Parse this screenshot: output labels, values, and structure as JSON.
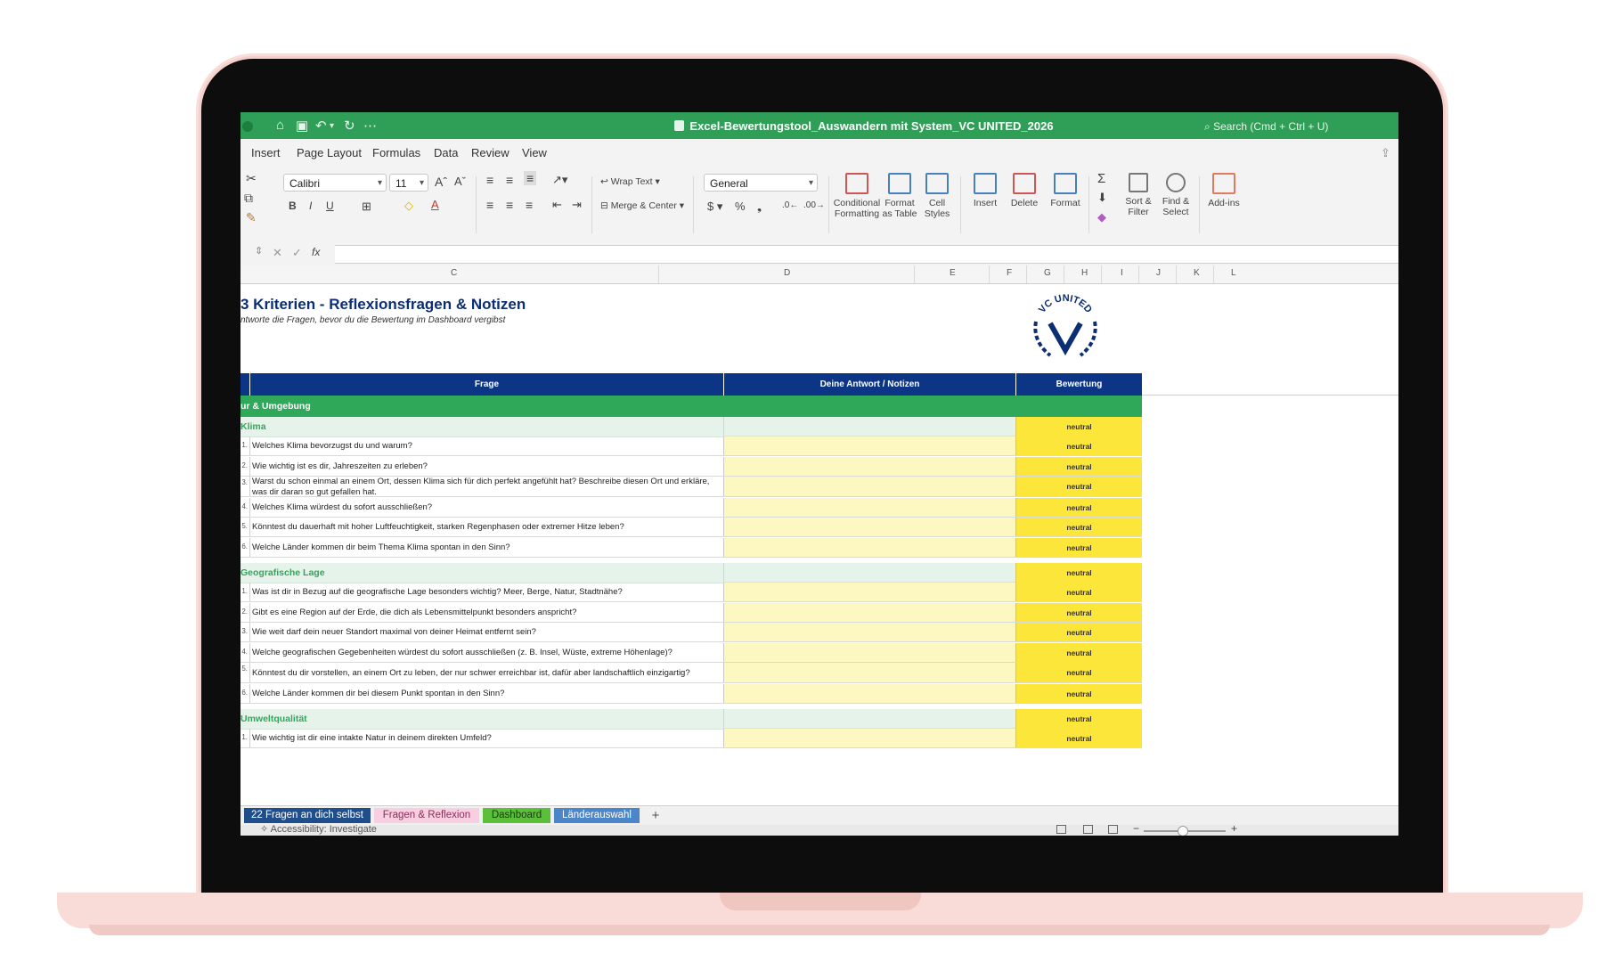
{
  "window": {
    "title": "Excel-Bewertungstool_Auswandern mit System_VC UNITED_2026",
    "search": "Search (Cmd + Ctrl + U)"
  },
  "menu": [
    "Insert",
    "Page Layout",
    "Formulas",
    "Data",
    "Review",
    "View"
  ],
  "ribbon": {
    "font_name": "Calibri",
    "font_size": "11",
    "wrap_text": "Wrap Text",
    "merge_center": "Merge & Center",
    "number_format": "General",
    "conditional_formatting": [
      "Conditional",
      "Formatting"
    ],
    "format_as_table": [
      "Format",
      "as Table"
    ],
    "cell_styles": [
      "Cell",
      "Styles"
    ],
    "insert": "Insert",
    "delete": "Delete",
    "format": "Format",
    "sort_filter": [
      "Sort &",
      "Filter"
    ],
    "find_select": [
      "Find &",
      "Select"
    ],
    "addins": "Add-ins",
    "fx": "fx"
  },
  "columns": [
    "C",
    "D",
    "E",
    "F",
    "G",
    "H",
    "I",
    "J",
    "K",
    "L"
  ],
  "sheet": {
    "title": "3 Kriterien - Reflexionsfragen & Notizen",
    "subtitle": "ntworte die Fragen, bevor du die Bewertung im Dashboard vergibst",
    "header": {
      "question": "Frage",
      "answer": "Deine Antwort / Notizen",
      "rating": "Bewertung"
    },
    "logo_text": "VC UNITED",
    "section": "ur & Umgebung",
    "categories": [
      {
        "label": "Klima",
        "rating": "neutral",
        "questions": [
          {
            "num": "1.",
            "text": "Welches Klima bevorzugst du und warum?",
            "rating": "neutral"
          },
          {
            "num": "2.",
            "text": "Wie wichtig ist es dir, Jahreszeiten zu erleben?",
            "rating": "neutral"
          },
          {
            "num": "3.",
            "text": "Warst du schon einmal an einem Ort, dessen Klima sich für dich perfekt angefühlt hat? Beschreibe diesen Ort und erkläre, was dir daran so gut gefallen hat.",
            "rating": "neutral"
          },
          {
            "num": "4.",
            "text": "Welches Klima würdest du sofort ausschließen?",
            "rating": "neutral"
          },
          {
            "num": "5.",
            "text": "Könntest du dauerhaft mit hoher Luftfeuchtigkeit, starken Regenphasen oder extremer Hitze leben?",
            "rating": "neutral"
          },
          {
            "num": "6.",
            "text": "Welche Länder kommen dir beim Thema Klima spontan in den Sinn?",
            "rating": "neutral"
          }
        ]
      },
      {
        "label": "Geografische Lage",
        "rating": "neutral",
        "questions": [
          {
            "num": "1.",
            "text": "Was ist dir in Bezug auf die geografische Lage besonders wichtig? Meer, Berge, Natur, Stadtnähe?",
            "rating": "neutral"
          },
          {
            "num": "2.",
            "text": "Gibt es eine Region auf der Erde, die dich als Lebensmittelpunkt besonders anspricht?",
            "rating": "neutral"
          },
          {
            "num": "3.",
            "text": "Wie weit darf dein neuer Standort maximal von deiner Heimat entfernt sein?",
            "rating": "neutral"
          },
          {
            "num": "4.",
            "text": "Welche geografischen Gegebenheiten würdest du sofort ausschließen (z. B. Insel, Wüste, extreme Höhenlage)?",
            "rating": "neutral"
          },
          {
            "num": "5.",
            "text": "Könntest du dir vorstellen, an einem Ort zu leben, der nur schwer erreichbar ist, dafür aber landschaftlich einzigartig?",
            "rating": "neutral"
          },
          {
            "num": "6.",
            "text": "Welche Länder kommen dir bei diesem Punkt spontan in den Sinn?",
            "rating": "neutral"
          }
        ]
      },
      {
        "label": "Umweltqualität",
        "rating": "neutral",
        "questions": [
          {
            "num": "1.",
            "text": "Wie wichtig ist dir eine intakte Natur in deinem direkten Umfeld?",
            "rating": "neutral"
          }
        ]
      }
    ]
  },
  "tabs": [
    {
      "label": "22 Fragen an dich selbst",
      "bg": "#1f4e8c",
      "fg": "#ffffff"
    },
    {
      "label": "Fragen & Reflexion",
      "bg": "#f7cfe0",
      "fg": "#8a2e5a"
    },
    {
      "label": "Dashboard",
      "bg": "#5bbf3a",
      "fg": "#1a3a10"
    },
    {
      "label": "Länderauswahl",
      "bg": "#4a86c8",
      "fg": "#ffffff"
    }
  ],
  "add_tab": "+",
  "status": {
    "accessibility": "Accessibility: Investigate",
    "zoom_minus": "−",
    "zoom_plus": "+"
  },
  "colors": {
    "title_bar": "#2f9f57",
    "header_blue": "#0c3586",
    "section_green": "#2fa85a",
    "category_bg": "#e6f3ea",
    "answer_yellow": "#fdf7c2",
    "rating_yellow": "#fde63a"
  }
}
